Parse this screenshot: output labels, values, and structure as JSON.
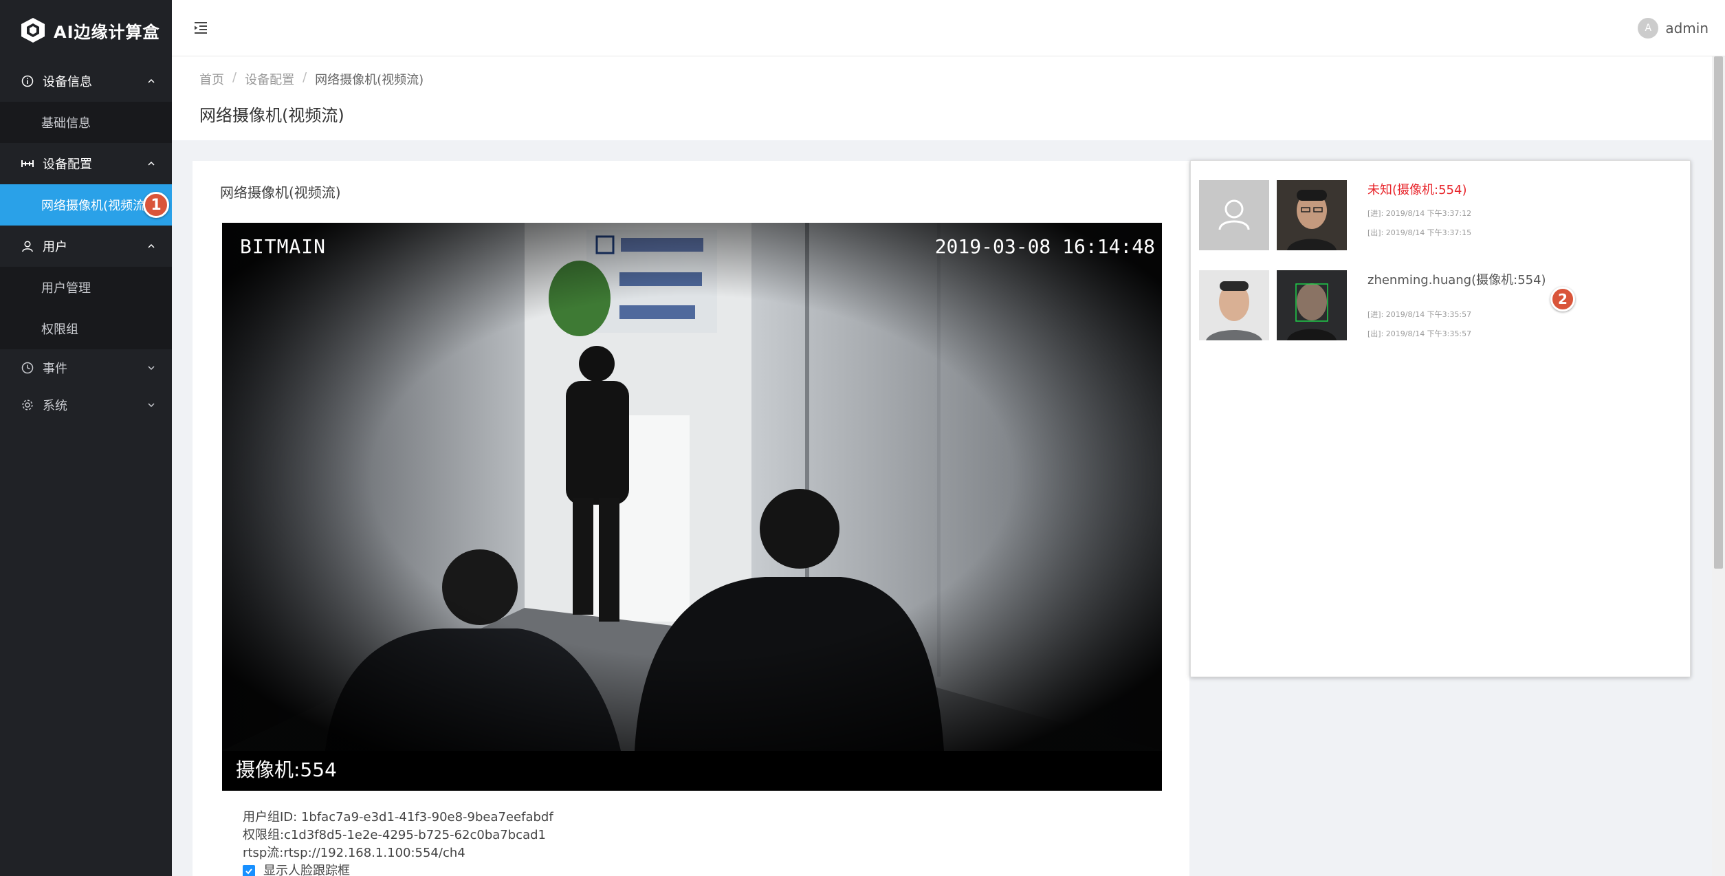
{
  "app": {
    "title": "AI边缘计算盒"
  },
  "sidebar": {
    "groups": [
      {
        "label": "设备信息",
        "expanded": true,
        "icon": "info-circle-icon",
        "items": [
          {
            "label": "基础信息"
          }
        ]
      },
      {
        "label": "设备配置",
        "expanded": true,
        "icon": "device-config-icon",
        "items": [
          {
            "label": "网络摄像机(视频流",
            "active": true,
            "badge": "1"
          }
        ]
      },
      {
        "label": "用户",
        "expanded": true,
        "icon": "user-icon",
        "items": [
          {
            "label": "用户管理"
          },
          {
            "label": "权限组"
          }
        ]
      },
      {
        "label": "事件",
        "expanded": false,
        "icon": "clock-icon",
        "items": []
      },
      {
        "label": "系统",
        "expanded": false,
        "icon": "gear-icon",
        "items": []
      }
    ]
  },
  "header": {
    "username": "admin",
    "avatar_letter": "A"
  },
  "breadcrumb": {
    "items": [
      "首页",
      "设备配置",
      "网络摄像机(视频流)"
    ],
    "separator": "/"
  },
  "page": {
    "title": "网络摄像机(视频流)"
  },
  "main": {
    "card_title": "网络摄像机(视频流)",
    "video": {
      "osd_left": "BITMAIN",
      "osd_right": "2019-03-08  16:14:48",
      "camera_label": "摄像机:554"
    },
    "info": {
      "group_id": "用户组ID: 1bfac7a9-e3d1-41f3-90e8-9bea7eefabdf",
      "permission_group": "权限组:c1d3f8d5-1e2e-4295-b725-62c0ba7bcad1",
      "rtsp": "rtsp流:rtsp://192.168.1.100:554/ch4",
      "show_face_box_label": "显示人脸跟踪框",
      "show_face_box_checked": true
    }
  },
  "recognition": {
    "records": [
      {
        "name": "未知(摄像机:554)",
        "name_color": "#e8252b",
        "in_time": "[进]: 2019/8/14 下午3:37:12",
        "out_time": "[出]: 2019/8/14 下午3:37:15",
        "registered_is_placeholder": true
      },
      {
        "name": "zhenming.huang(摄像机:554)",
        "name_color": "#555555",
        "in_time": "[进]: 2019/8/14 下午3:35:57",
        "out_time": "[出]: 2019/8/14 下午3:35:57",
        "registered_is_placeholder": false,
        "badge": "2"
      }
    ]
  },
  "colors": {
    "sidebar_bg": "#202226",
    "active": "#2aa1e8",
    "badge": "#d9553a"
  }
}
